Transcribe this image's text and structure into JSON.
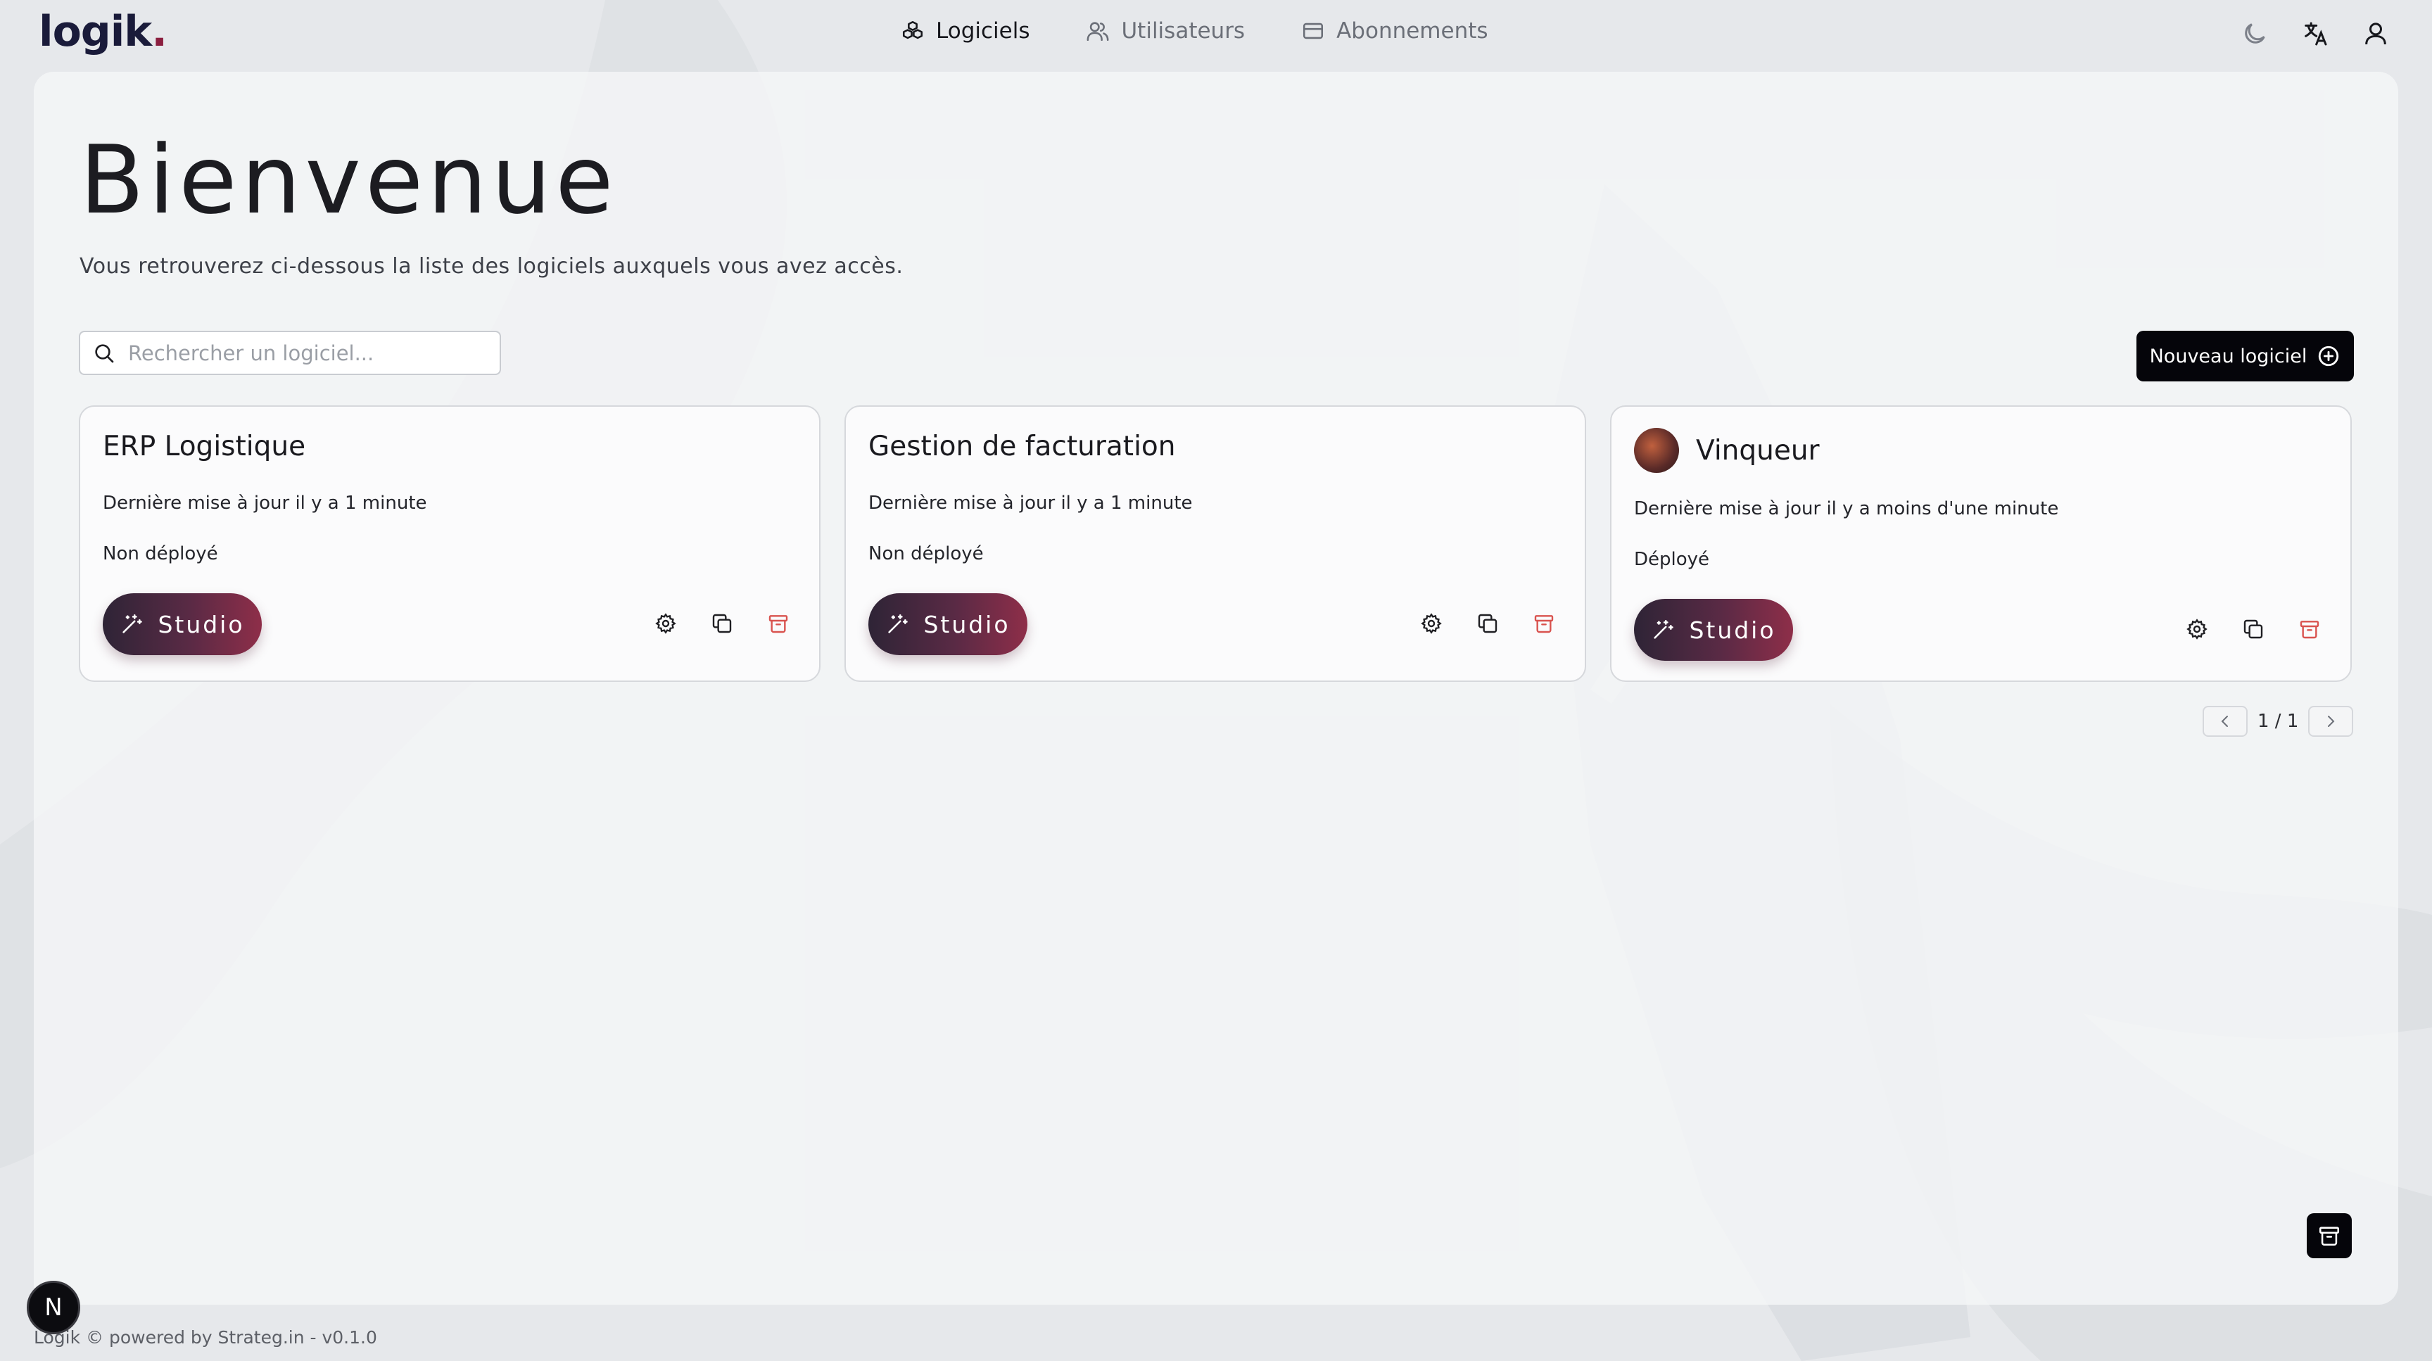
{
  "brand": {
    "name": "logik",
    "dot": "."
  },
  "nav": [
    {
      "label": "Logiciels",
      "icon": "boxes-icon",
      "active": true
    },
    {
      "label": "Utilisateurs",
      "icon": "users-icon",
      "active": false
    },
    {
      "label": "Abonnements",
      "icon": "credit-card-icon",
      "active": false
    }
  ],
  "top_icons": [
    "moon-icon",
    "translate-icon",
    "user-icon"
  ],
  "page": {
    "title": "Bienvenue",
    "subtitle": "Vous retrouverez ci-dessous la liste des logiciels auxquels vous avez accès."
  },
  "search": {
    "placeholder": "Rechercher un logiciel..."
  },
  "new_button": {
    "label": "Nouveau logiciel"
  },
  "cards": [
    {
      "title": "ERP Logistique",
      "updated": "Dernière mise à jour il y a 1 minute",
      "status": "Non déployé",
      "studio_label": "Studio",
      "has_avatar": false
    },
    {
      "title": "Gestion de facturation",
      "updated": "Dernière mise à jour il y a 1 minute",
      "status": "Non déployé",
      "studio_label": "Studio",
      "has_avatar": false
    },
    {
      "title": "Vinqueur",
      "updated": "Dernière mise à jour il y a moins d'une minute",
      "status": "Déployé",
      "studio_label": "Studio",
      "has_avatar": true
    }
  ],
  "pager": {
    "label": "1 / 1"
  },
  "badge": {
    "letter": "N"
  },
  "footer": {
    "text": "Logik © powered by Strateg.in - v0.1.0"
  },
  "colors": {
    "accent_dark": "#05050a",
    "studio_start": "#2e2436",
    "studio_end": "#8e2e49",
    "danger": "#d9534f"
  }
}
